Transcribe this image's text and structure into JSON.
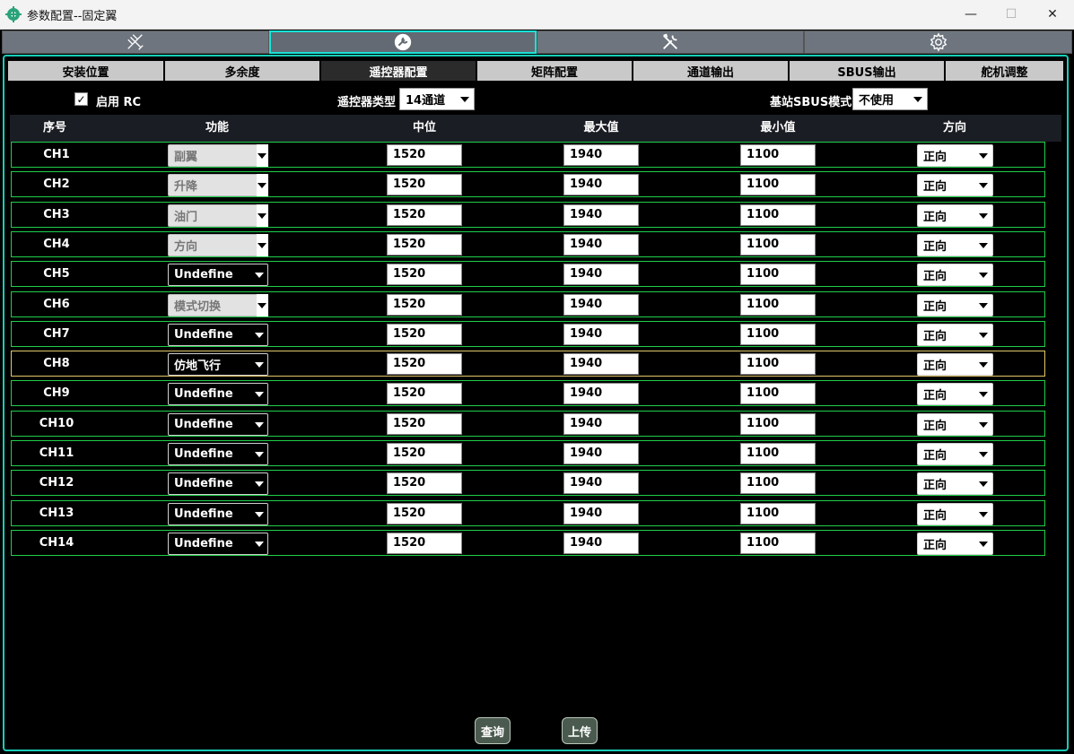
{
  "window": {
    "title": "参数配置--固定翼",
    "min_label": "—",
    "max_label": "☐",
    "close_label": "✕"
  },
  "toolbar": {
    "tools": [
      "airframe-icon",
      "rc-config-icon",
      "tools-icon",
      "settings-icon"
    ],
    "active": 1
  },
  "subtabs": [
    "安装位置",
    "多余度",
    "遥控器配置",
    "矩阵配置",
    "通道输出",
    "SBUS输出",
    "舵机调整"
  ],
  "options": {
    "enable_rc_label": "启用 RC",
    "enable_rc_checked": true,
    "rc_type_label": "遥控器类型",
    "rc_type_value": "14通道",
    "sbus_mode_label": "基站SBUS模式",
    "sbus_mode_value": "不使用"
  },
  "table": {
    "headers": [
      "序号",
      "功能",
      "中位",
      "最大值",
      "最小值",
      "方向"
    ],
    "rows": [
      {
        "ch": "CH1",
        "fn": "副翼",
        "locked": true,
        "mid": "1520",
        "max": "1940",
        "min": "1100",
        "dir": "正向"
      },
      {
        "ch": "CH2",
        "fn": "升降",
        "locked": true,
        "mid": "1520",
        "max": "1940",
        "min": "1100",
        "dir": "正向"
      },
      {
        "ch": "CH3",
        "fn": "油门",
        "locked": true,
        "mid": "1520",
        "max": "1940",
        "min": "1100",
        "dir": "正向"
      },
      {
        "ch": "CH4",
        "fn": "方向",
        "locked": true,
        "mid": "1520",
        "max": "1940",
        "min": "1100",
        "dir": "正向"
      },
      {
        "ch": "CH5",
        "fn": "Undefine",
        "locked": false,
        "mid": "1520",
        "max": "1940",
        "min": "1100",
        "dir": "正向"
      },
      {
        "ch": "CH6",
        "fn": "模式切换",
        "locked": true,
        "mid": "1520",
        "max": "1940",
        "min": "1100",
        "dir": "正向"
      },
      {
        "ch": "CH7",
        "fn": "Undefine",
        "locked": false,
        "mid": "1520",
        "max": "1940",
        "min": "1100",
        "dir": "正向"
      },
      {
        "ch": "CH8",
        "fn": "仿地飞行",
        "locked": false,
        "mid": "1520",
        "max": "1940",
        "min": "1100",
        "dir": "正向"
      },
      {
        "ch": "CH9",
        "fn": "Undefine",
        "locked": false,
        "mid": "1520",
        "max": "1940",
        "min": "1100",
        "dir": "正向"
      },
      {
        "ch": "CH10",
        "fn": "Undefine",
        "locked": false,
        "mid": "1520",
        "max": "1940",
        "min": "1100",
        "dir": "正向"
      },
      {
        "ch": "CH11",
        "fn": "Undefine",
        "locked": false,
        "mid": "1520",
        "max": "1940",
        "min": "1100",
        "dir": "正向"
      },
      {
        "ch": "CH12",
        "fn": "Undefine",
        "locked": false,
        "mid": "1520",
        "max": "1940",
        "min": "1100",
        "dir": "正向"
      },
      {
        "ch": "CH13",
        "fn": "Undefine",
        "locked": false,
        "mid": "1520",
        "max": "1940",
        "min": "1100",
        "dir": "正向"
      },
      {
        "ch": "CH14",
        "fn": "Undefine",
        "locked": false,
        "mid": "1520",
        "max": "1940",
        "min": "1100",
        "dir": "正向"
      }
    ],
    "selected_row": 7
  },
  "buttons": {
    "query": "查询",
    "upload": "上传"
  },
  "colors": {
    "accent": "#19cdb8",
    "row_border": "#1fcf4a",
    "selected_border": "#e2c86a"
  }
}
